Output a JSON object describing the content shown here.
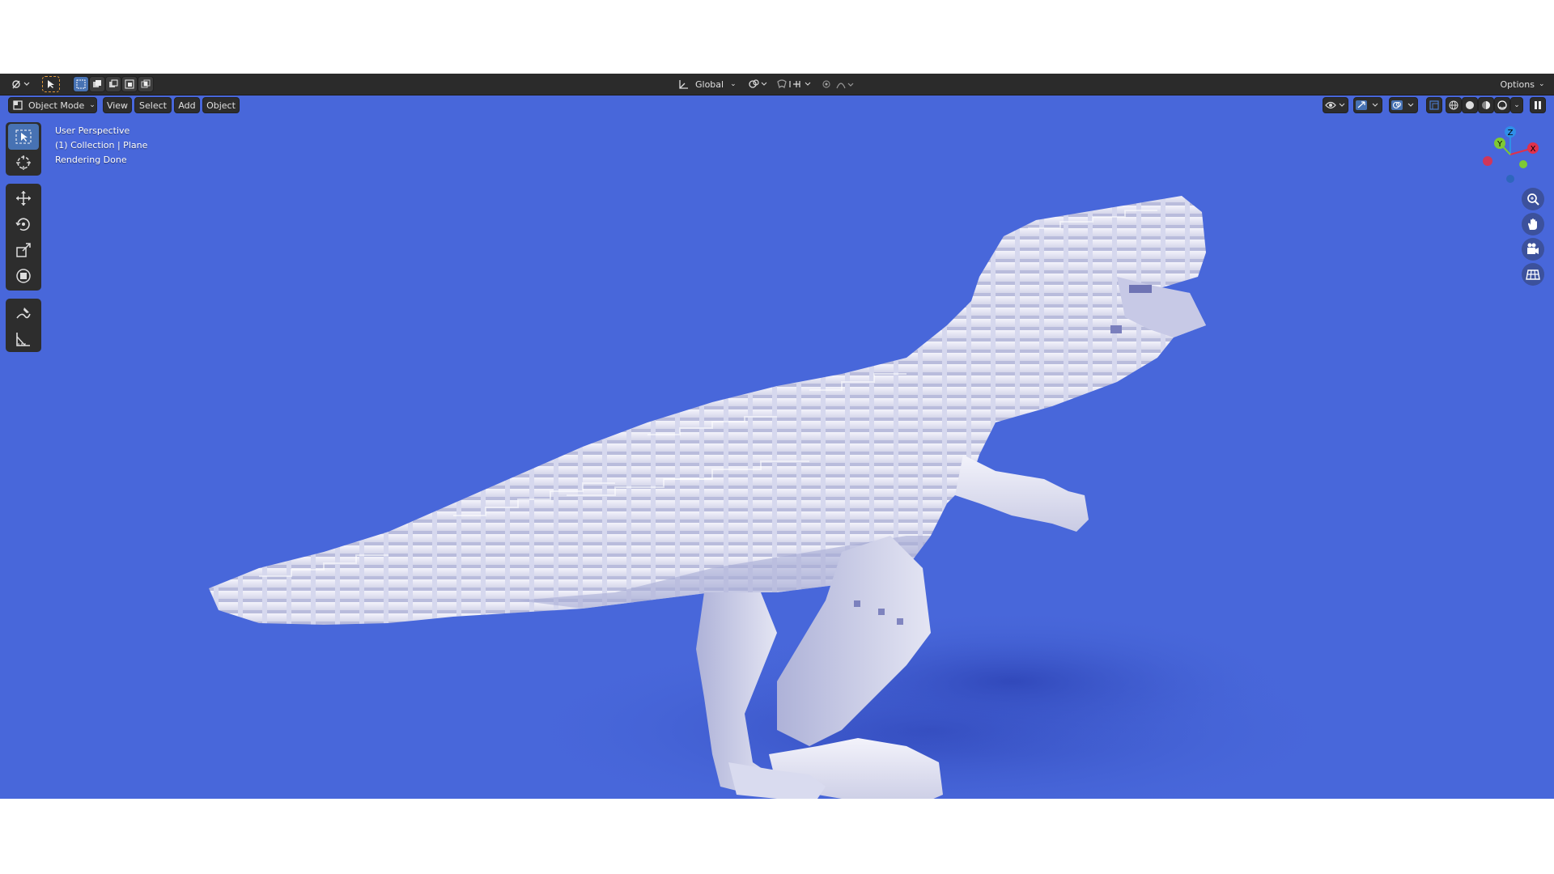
{
  "header": {
    "transform_orientation": "Global",
    "options_label": "Options"
  },
  "viewport_header": {
    "mode_label": "Object Mode",
    "menus": [
      "View",
      "Select",
      "Add",
      "Object"
    ]
  },
  "overlay_info": {
    "line1": "User Perspective",
    "line2": "(1) Collection | Plane",
    "line3": "Rendering Done"
  },
  "gizmo": {
    "z_label": "Z",
    "y_label": "Y",
    "x_label": "X"
  },
  "colors": {
    "viewport_background": "#4867da",
    "header_background": "#2b2b2b",
    "active_tool": "#4772b3",
    "axis_x": "#e0314b",
    "axis_y": "#7ec934",
    "axis_z": "#2f8fe8"
  },
  "icons": {
    "editor_type": "editor-type-icon",
    "select": "select-cursor-icon",
    "cursor": "3d-cursor-icon",
    "move": "move-icon",
    "rotate": "rotate-icon",
    "scale": "scale-icon",
    "transform": "transform-icon",
    "annotate": "annotate-icon",
    "measure": "measure-icon",
    "zoom": "zoom-icon",
    "pan": "hand-pan-icon",
    "camera": "camera-icon",
    "grid": "grid-icon"
  }
}
